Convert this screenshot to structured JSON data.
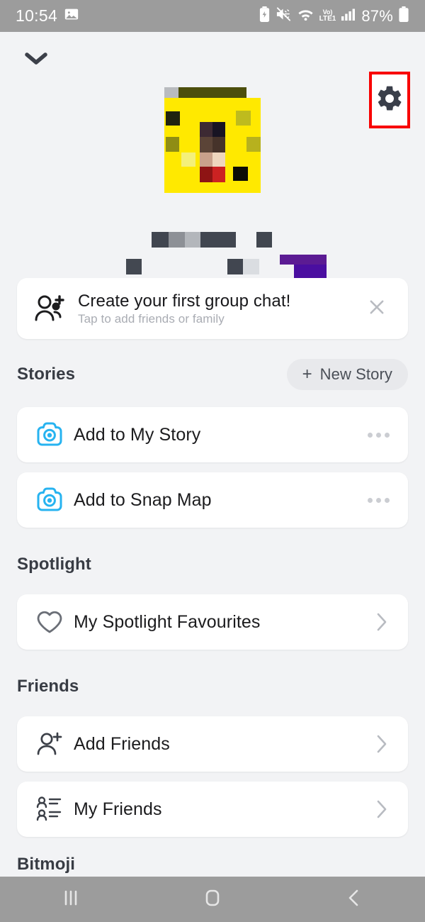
{
  "status_bar": {
    "clock": "10:54",
    "battery_percent": "87%",
    "volte_top": "Vo)",
    "volte_bottom": "LTE1",
    "icons": [
      "image-icon",
      "battery-saver-icon",
      "mute-icon",
      "wifi-icon",
      "volte-icon",
      "signal-icon",
      "battery-icon"
    ]
  },
  "header": {
    "collapse_icon": "chevron-down-icon",
    "settings_icon": "gear-icon",
    "highlight_color": "#f80000"
  },
  "profile": {
    "avatar_state": "pixelated",
    "display_name_state": "pixelated",
    "username_state": "pixelated"
  },
  "promo": {
    "icon": "group-add-icon",
    "title": "Create your first group chat!",
    "subtitle": "Tap to add friends or family",
    "close_icon": "close-icon"
  },
  "sections": {
    "stories": {
      "title": "Stories",
      "action_label": "New Story",
      "action_plus": "+",
      "rows": [
        {
          "icon": "camera-icon",
          "label": "Add to My Story",
          "trailing": "more-dots-icon"
        },
        {
          "icon": "camera-icon",
          "label": "Add to Snap Map",
          "trailing": "more-dots-icon"
        }
      ]
    },
    "spotlight": {
      "title": "Spotlight",
      "rows": [
        {
          "icon": "heart-icon",
          "label": "My Spotlight Favourites",
          "trailing": "chevron-right-icon"
        }
      ]
    },
    "friends": {
      "title": "Friends",
      "rows": [
        {
          "icon": "person-add-icon",
          "label": "Add Friends",
          "trailing": "chevron-right-icon"
        },
        {
          "icon": "friend-list-icon",
          "label": "My Friends",
          "trailing": "chevron-right-icon"
        }
      ]
    },
    "bitmoji": {
      "title": "Bitmoji"
    }
  },
  "nav_bar": {
    "recents_icon": "recents-icon",
    "home_icon": "home-icon",
    "back_icon": "back-icon"
  },
  "colors": {
    "background": "#f2f3f5",
    "card": "#ffffff",
    "accent_blue": "#26b5f2",
    "text_primary": "#1c1c1e",
    "text_muted": "#a9acb3",
    "system_gray": "#9c9c9c",
    "highlight_red": "#f80000"
  }
}
